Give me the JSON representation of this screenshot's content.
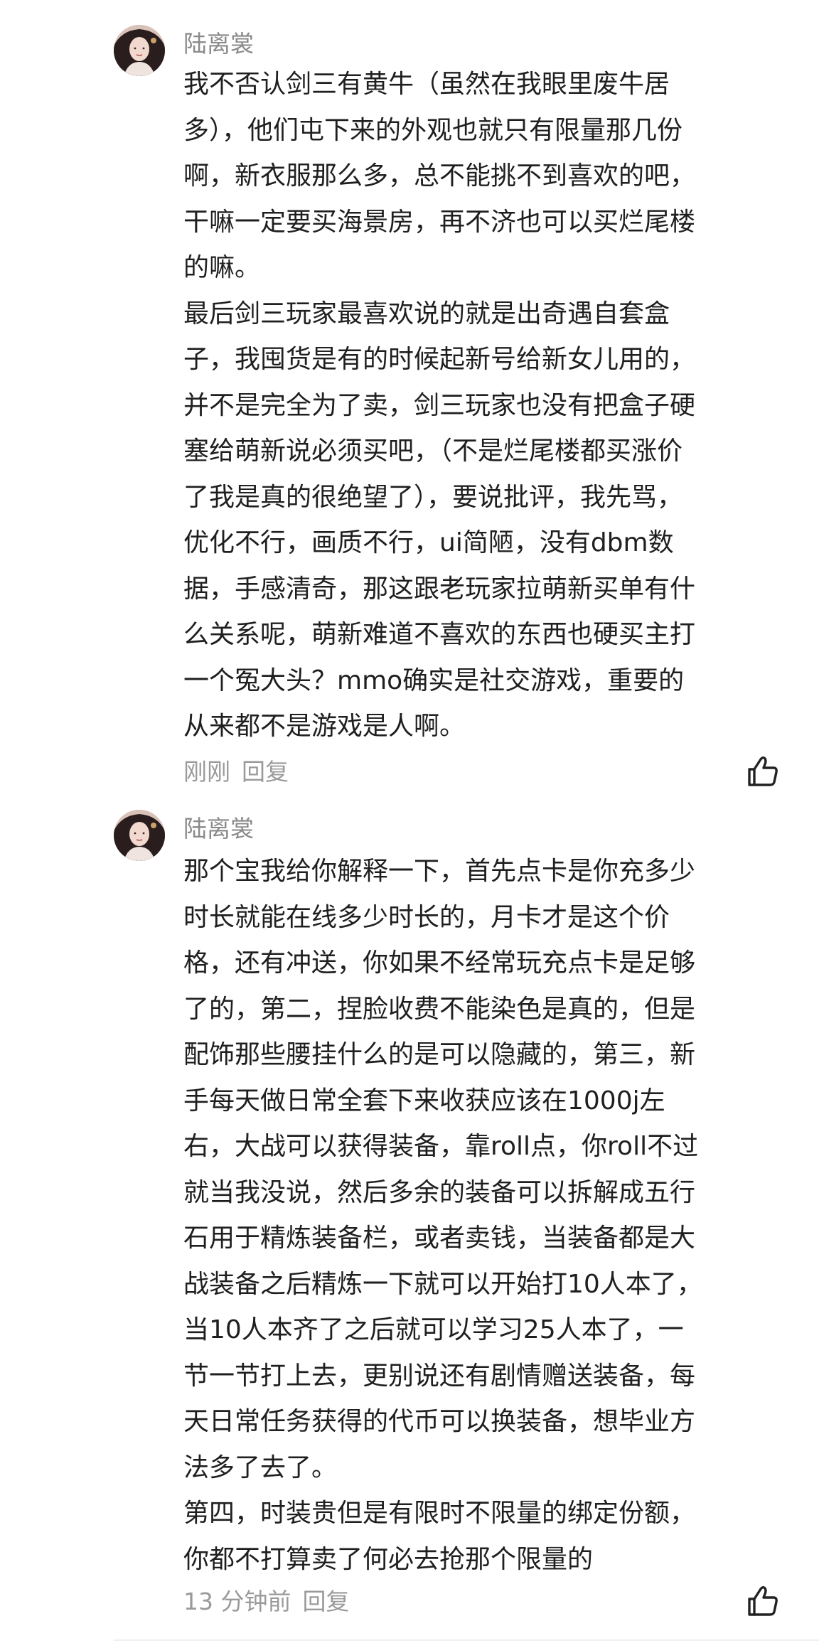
{
  "comments": [
    {
      "username": "陆离裳",
      "paragraphs": [
        "我不否认剑三有黄牛（虽然在我眼里废牛居\n多），他们屯下来的外观也就只有限量那几份\n啊，新衣服那么多，总不能挑不到喜欢的吧，\n干嘛一定要买海景房，再不济也可以买烂尾楼\n的嘛。",
        "最后剑三玩家最喜欢说的就是出奇遇自套盒\n子，我囤货是有的时候起新号给新女儿用的，\n并不是完全为了卖，剑三玩家也没有把盒子硬\n塞给萌新说必须买吧，（不是烂尾楼都买涨价\n了我是真的很绝望了），要说批评，我先骂，\n优化不行，画质不行，ui简陋，没有dbm数\n据，手感清奇，那这跟老玩家拉萌新买单有什\n么关系呢，萌新难道不喜欢的东西也硬买主打\n一个冤大头？mmo确实是社交游戏，重要的\n从来都不是游戏是人啊。"
      ],
      "time": "刚刚",
      "reply_label": "回复"
    },
    {
      "username": "陆离裳",
      "paragraphs": [
        "那个宝我给你解释一下，首先点卡是你充多少\n时长就能在线多少时长的，月卡才是这个价\n格，还有冲送，你如果不经常玩充点卡是足够\n了的，第二，捏脸收费不能染色是真的，但是\n配饰那些腰挂什么的是可以隐藏的，第三，新\n手每天做日常全套下来收获应该在1000j左\n右，大战可以获得装备，靠roll点，你roll不过\n就当我没说，然后多余的装备可以拆解成五行\n石用于精炼装备栏，或者卖钱，当装备都是大\n战装备之后精炼一下就可以开始打10人本了，\n当10人本齐了之后就可以学习25人本了，一\n节一节打上去，更别说还有剧情赠送装备，每\n天日常任务获得的代币可以换装备，想毕业方\n法多了去了。",
        "第四，时装贵但是有限时不限量的绑定份额，\n你都不打算卖了何必去抢那个限量的"
      ],
      "time": "13 分钟前",
      "reply_label": "回复"
    }
  ],
  "icons": {
    "like": "thumbs-up-icon",
    "avatar": "avatar-portrait"
  },
  "colors": {
    "text": "#1f1f1f",
    "meta": "#9a9a9a",
    "username": "#8a8a8a"
  }
}
